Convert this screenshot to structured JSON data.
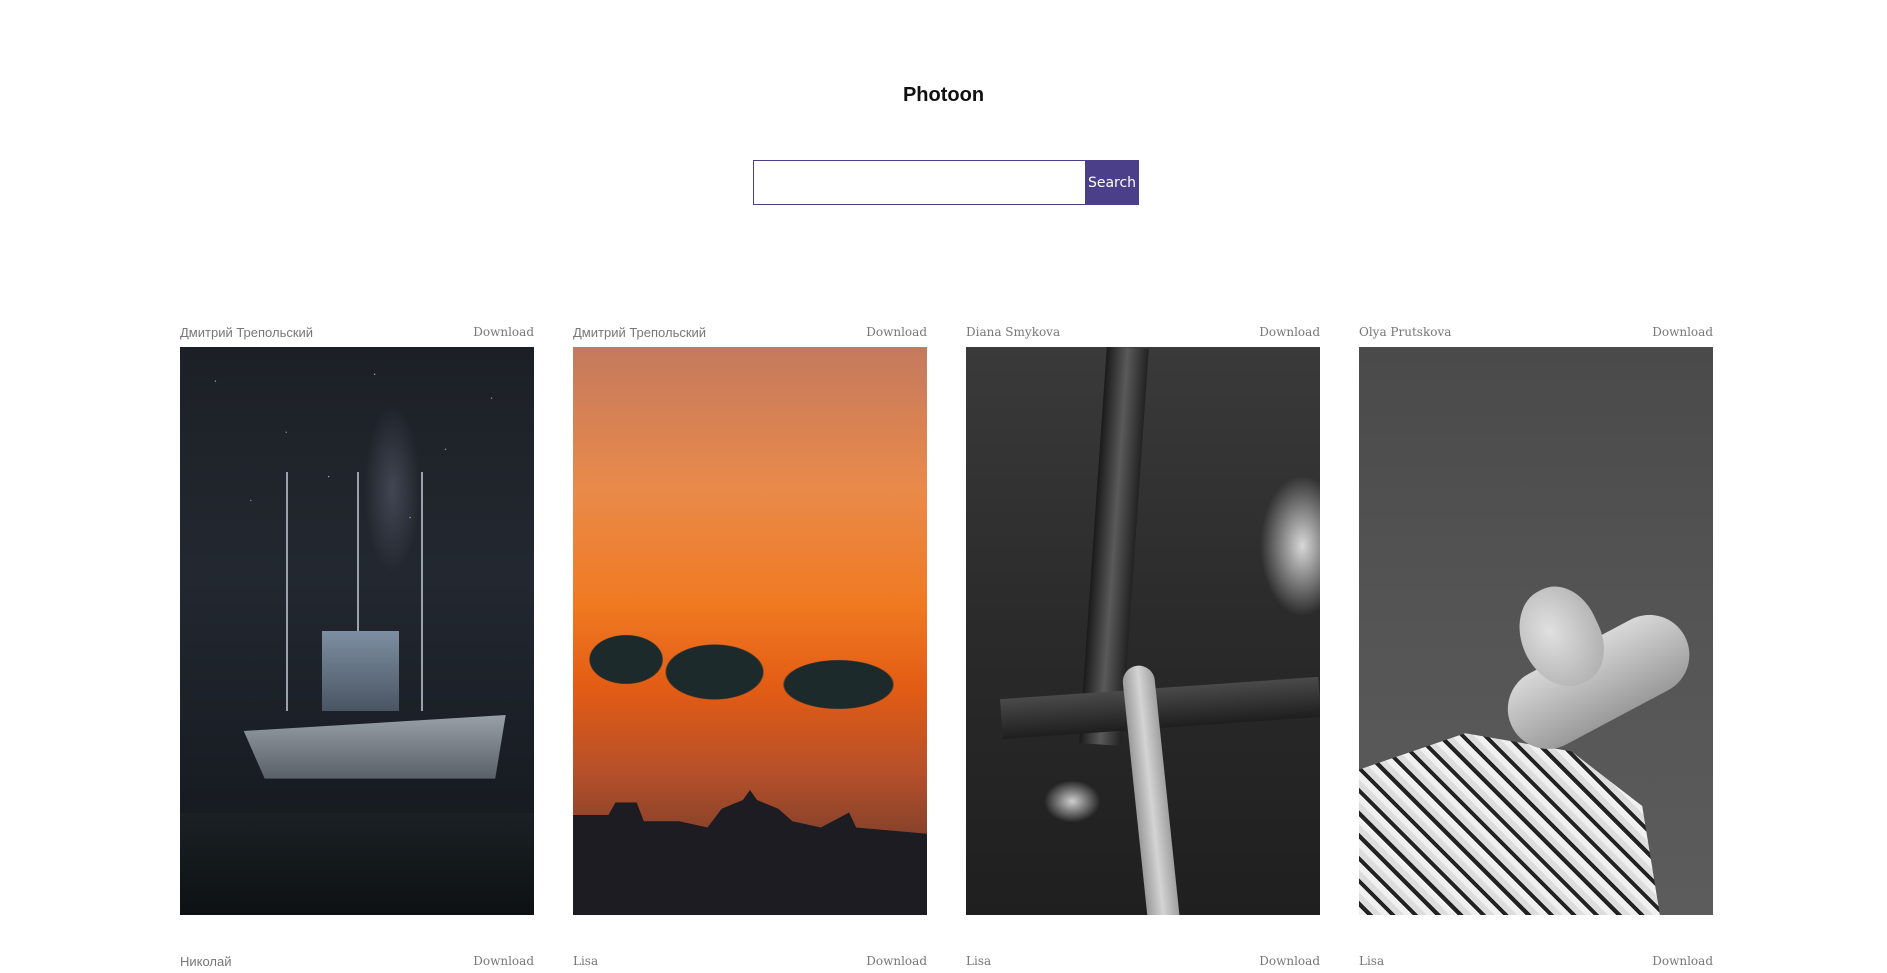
{
  "app": {
    "title": "Photoon"
  },
  "search": {
    "value": "",
    "placeholder": "",
    "button_label": "Search"
  },
  "photos": [
    {
      "author": "Дмитрий Трепольский",
      "download_label": "Download",
      "subject": "ship-at-night"
    },
    {
      "author": "Дмитрий Трепольский",
      "download_label": "Download",
      "subject": "sunset-cathedral"
    },
    {
      "author": "Diana Smykova",
      "download_label": "Download",
      "subject": "hand-on-tree"
    },
    {
      "author": "Olya Prutskova",
      "download_label": "Download",
      "subject": "portrait"
    },
    {
      "author": "Николай",
      "download_label": "Download",
      "subject": ""
    },
    {
      "author": "Lisa",
      "download_label": "Download",
      "subject": ""
    },
    {
      "author": "Lisa",
      "download_label": "Download",
      "subject": ""
    },
    {
      "author": "Lisa",
      "download_label": "Download",
      "subject": ""
    }
  ],
  "colors": {
    "accent": "#4b3f8a",
    "meta_text": "#777777"
  }
}
